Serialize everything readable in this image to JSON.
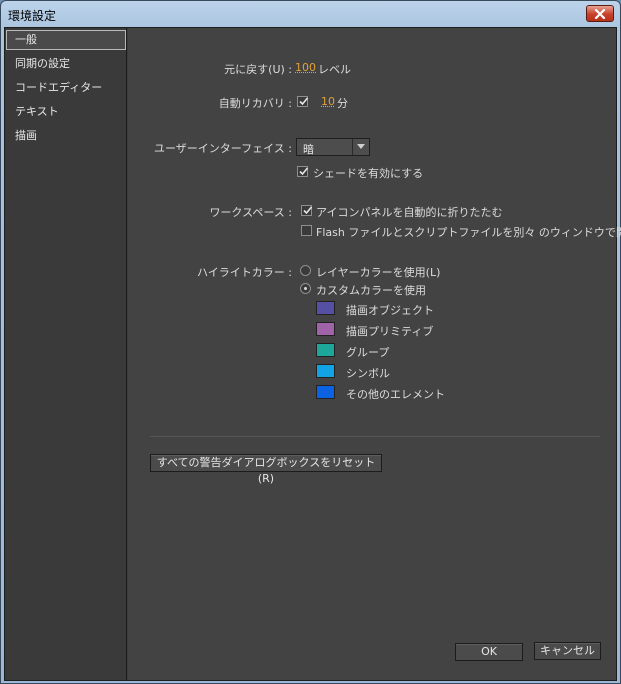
{
  "window": {
    "title": "環境設定"
  },
  "sidebar": {
    "items": [
      {
        "label": "一般"
      },
      {
        "label": "同期の設定"
      },
      {
        "label": "コードエディター"
      },
      {
        "label": "テキスト"
      },
      {
        "label": "描画"
      }
    ],
    "selected_index": 0
  },
  "general": {
    "undo": {
      "label": "元に戻す(U) :",
      "value": "100",
      "unit": "レベル"
    },
    "autorecover": {
      "label": "自動リカバリ :",
      "checked": true,
      "value": "10",
      "unit": "分"
    },
    "ui": {
      "label": "ユーザーインターフェイス :",
      "value": "暗",
      "shading_label": "シェードを有効にする",
      "shading_checked": true
    },
    "workspace": {
      "label": "ワークスペース :",
      "auto_collapse_label": "アイコンパネルを自動的に折りたたむ",
      "auto_collapse_checked": true,
      "separate_windows_label": "Flash ファイルとスクリプトファイルを別々 のウィンドウで開く",
      "separate_windows_checked": false
    },
    "highlight": {
      "label": "ハイライトカラー :",
      "layer_color_label": "レイヤーカラーを使用(L)",
      "custom_color_label": "カスタムカラーを使用",
      "selected": "custom",
      "colors": [
        {
          "label": "描画オブジェクト",
          "color": "#5550a3"
        },
        {
          "label": "描画プリミティブ",
          "color": "#a163a8"
        },
        {
          "label": "グループ",
          "color": "#1da69a"
        },
        {
          "label": "シンボル",
          "color": "#12a3e6"
        },
        {
          "label": "その他のエレメント",
          "color": "#0b63e4"
        }
      ]
    },
    "reset_label": "すべての警告ダイアログボックスをリセット(R)"
  },
  "footer": {
    "ok_label": "OK",
    "cancel_label": "キャンセル"
  }
}
